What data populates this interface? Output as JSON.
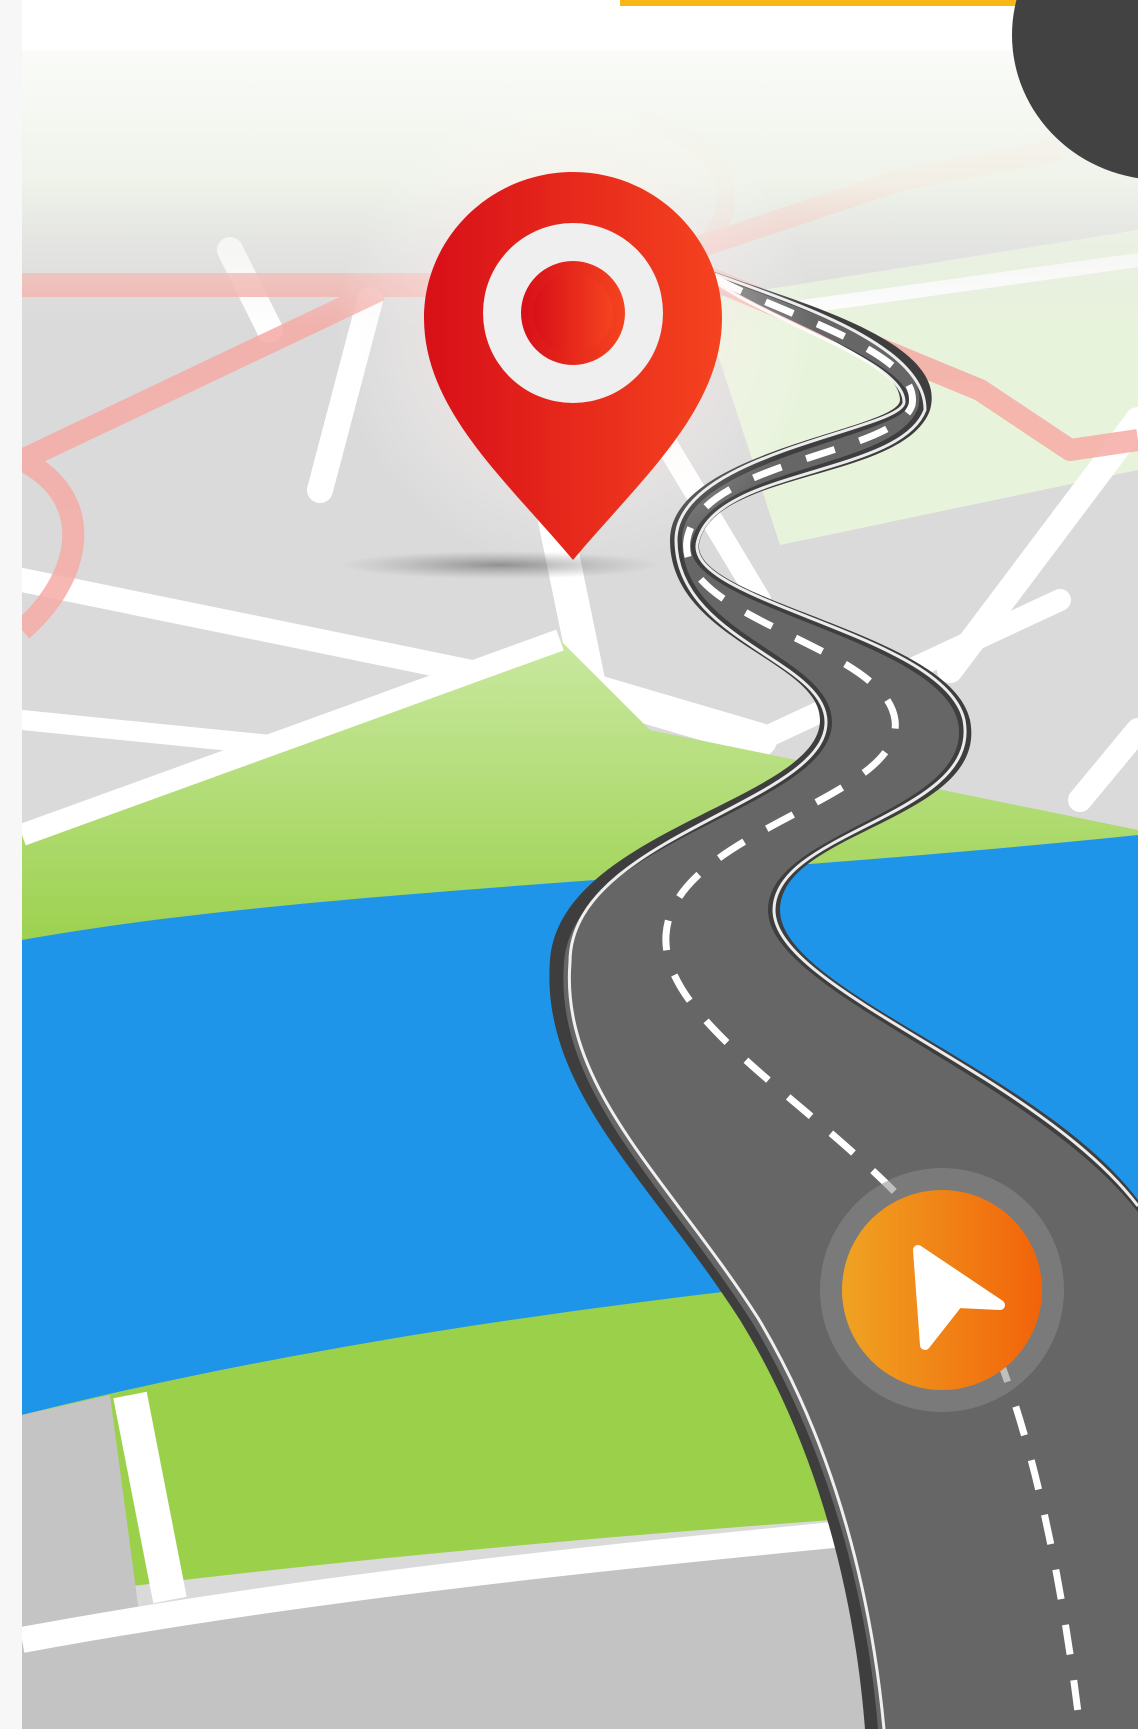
{
  "colors": {
    "page_background": "#f7f7f7",
    "accent_tab": "#f9b717",
    "corner_shape": "#424242",
    "land_grey": "#d9d9d9",
    "land_grey_dark": "#c4c4c4",
    "street_white": "#ffffff",
    "park_green": "#9bd14a",
    "park_green_light": "#c8e89a",
    "water_blue": "#1f95ea",
    "highway_red": "#f5a7a2",
    "road_asphalt": "#666666",
    "road_edge": "#3d3d3d",
    "road_marking": "#ffffff",
    "destination_pin": "#e0161d",
    "destination_pin_light": "#f43a25",
    "navigation_marker": "#f07a12",
    "navigation_marker_light": "#f2a01f"
  },
  "icons": {
    "destination": "map-pin-icon",
    "current_position": "navigation-arrow-icon"
  }
}
